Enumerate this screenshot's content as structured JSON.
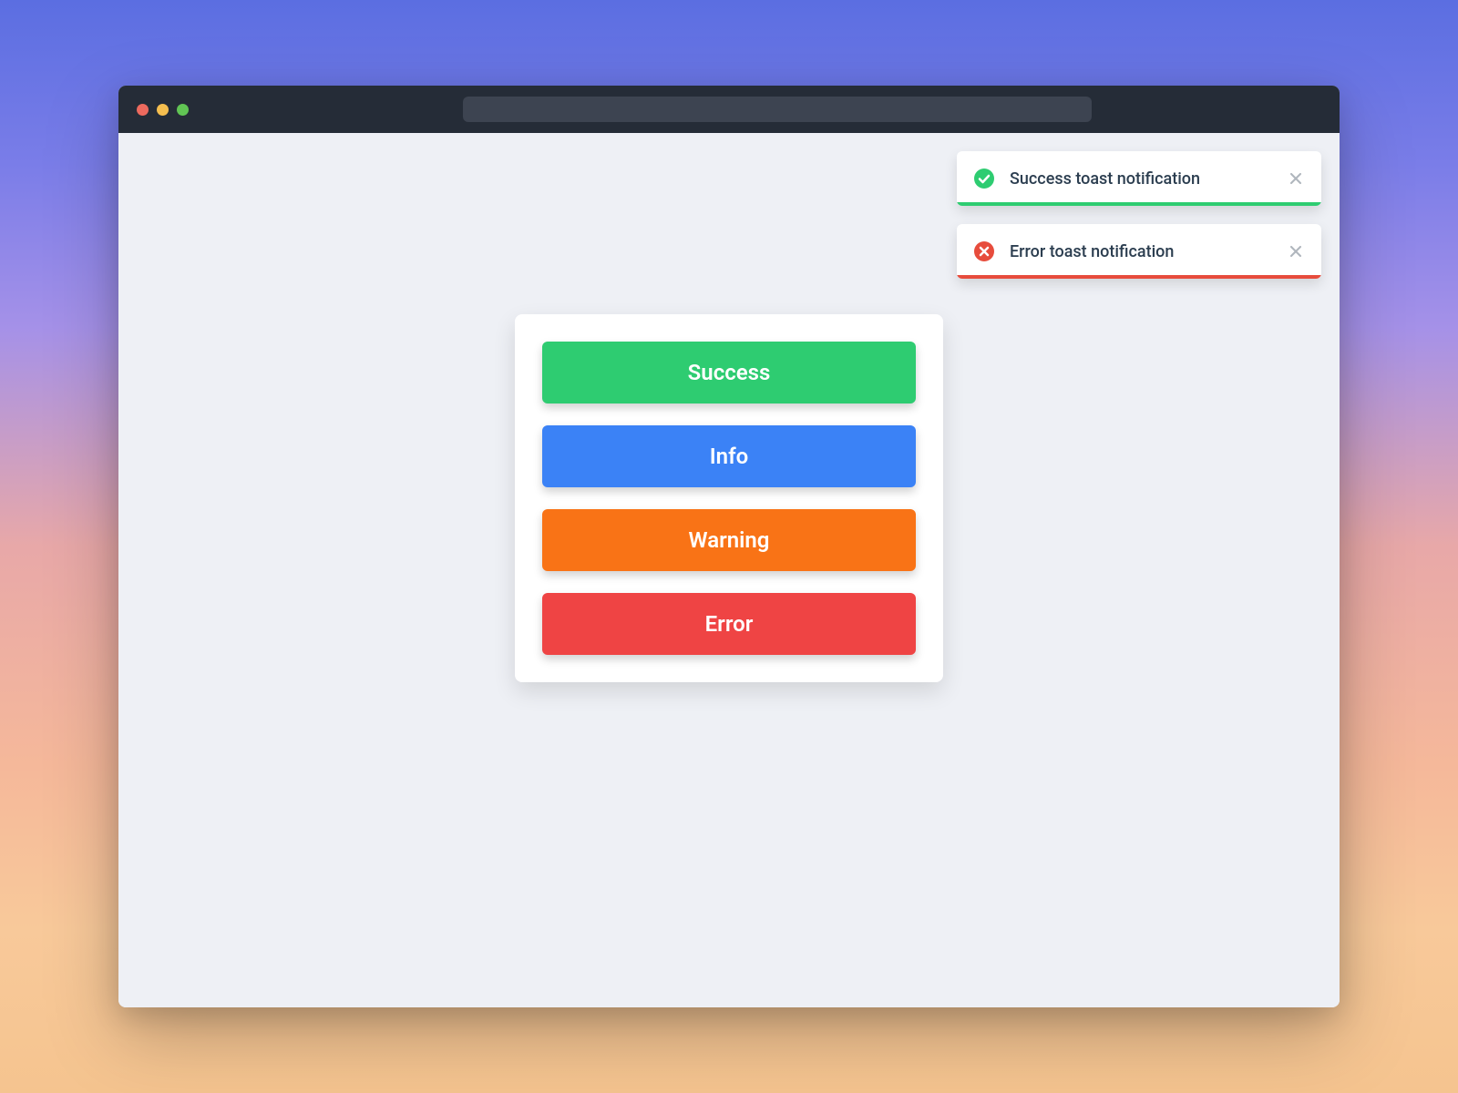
{
  "toasts": [
    {
      "text": "Success toast notification",
      "type": "success"
    },
    {
      "text": "Error toast notification",
      "type": "error"
    }
  ],
  "buttons": {
    "success": "Success",
    "info": "Info",
    "warning": "Warning",
    "error": "Error"
  },
  "colors": {
    "success": "#2ecc71",
    "info": "#3b82f6",
    "warning": "#f97316",
    "error": "#ef4444"
  }
}
